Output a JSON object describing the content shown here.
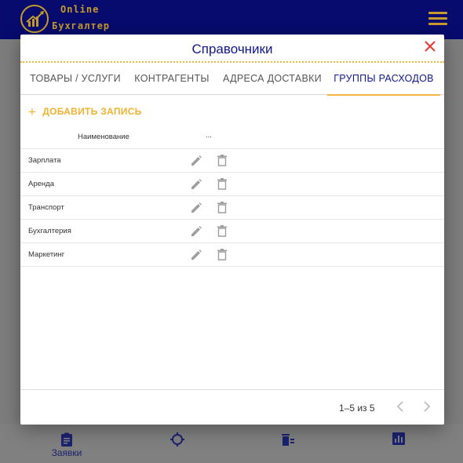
{
  "app": {
    "logo_line1": "Online",
    "logo_line2": "Бухгалтер"
  },
  "bottom_nav": {
    "items": [
      {
        "label": "Заявки",
        "icon": "clipboard-icon"
      },
      {
        "label": "",
        "icon": "target-icon"
      },
      {
        "label": "",
        "icon": "trash-list-icon"
      },
      {
        "label": "",
        "icon": "chart-icon"
      }
    ]
  },
  "dialog": {
    "title": "Справочники",
    "tabs": [
      {
        "label": "ТОВАРЫ / УСЛУГИ",
        "active": false
      },
      {
        "label": "КОНТРАГЕНТЫ",
        "active": false
      },
      {
        "label": "АДРЕСА ДОСТАВКИ",
        "active": false
      },
      {
        "label": "ГРУППЫ РАСХОДОВ",
        "active": true
      }
    ],
    "add_label": "ДОБАВИТЬ ЗАПИСЬ",
    "table": {
      "columns": [
        "Наименование",
        "..."
      ],
      "rows": [
        {
          "name": "Зарплата"
        },
        {
          "name": "Аренда"
        },
        {
          "name": "Транспорт"
        },
        {
          "name": "Бухгалтерия"
        },
        {
          "name": "Маркетинг"
        }
      ]
    },
    "pagination": {
      "range": "1–5 из 5"
    }
  },
  "colors": {
    "header_bg": "#060b6d",
    "accent": "#f3b63e",
    "title": "#12188a",
    "close": "#e53935"
  }
}
